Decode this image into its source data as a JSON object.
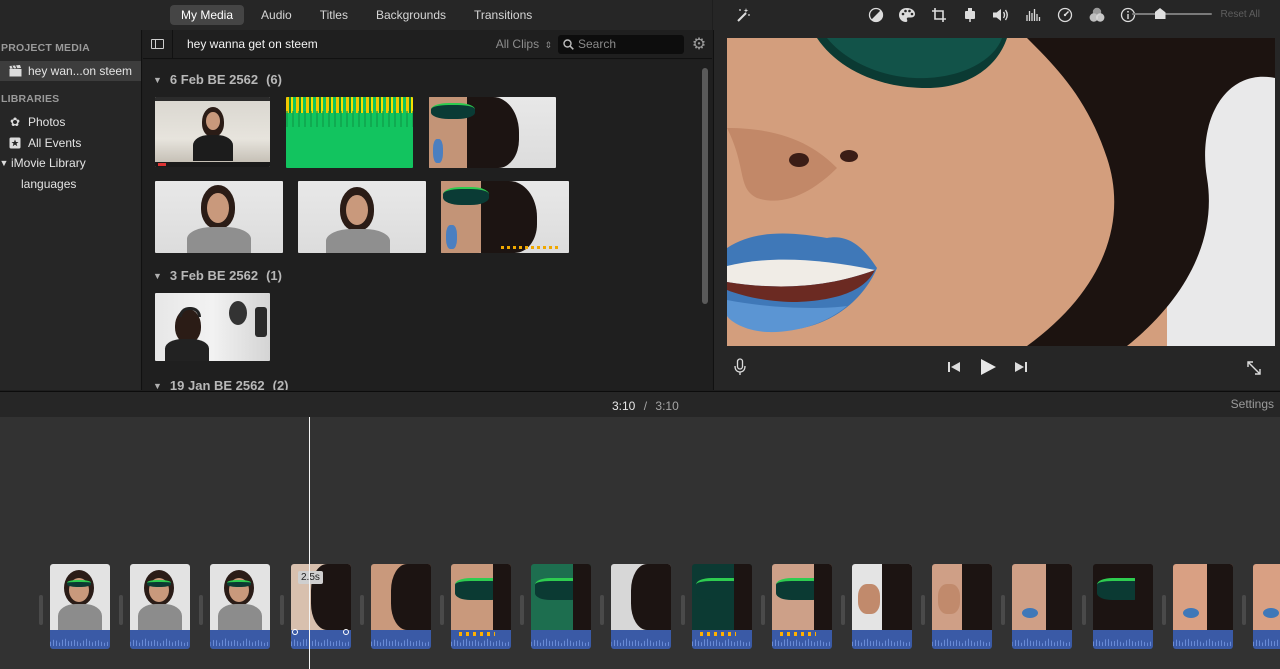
{
  "tabs": [
    {
      "label": "My Media",
      "active": true
    },
    {
      "label": "Audio",
      "active": false
    },
    {
      "label": "Titles",
      "active": false
    },
    {
      "label": "Backgrounds",
      "active": false
    },
    {
      "label": "Transitions",
      "active": false
    }
  ],
  "sidebar": {
    "project_media_heading": "PROJECT MEDIA",
    "project_item": "hey wan...on steem",
    "libraries_heading": "LIBRARIES",
    "photos": "Photos",
    "all_events": "All Events",
    "library": "iMovie Library",
    "library_child": "languages"
  },
  "browser": {
    "project_name": "hey wanna get on steem",
    "filter": "All Clips",
    "search_placeholder": "Search",
    "events": [
      {
        "title": "6 Feb BE 2562",
        "count": "(6)"
      },
      {
        "title": "3 Feb BE 2562",
        "count": "(1)"
      },
      {
        "title": "19 Jan BE 2562",
        "count": "(2)"
      }
    ]
  },
  "viewer": {
    "reset_all": "Reset All",
    "toolbar_icons": [
      "magic-wand-icon",
      "color-balance-icon",
      "color-correction-icon",
      "crop-icon",
      "stabilization-icon",
      "volume-icon",
      "noise-reduction-icon",
      "speed-icon",
      "clip-filter-icon",
      "info-icon"
    ]
  },
  "timeline": {
    "current_time": "3:10",
    "separator": "/",
    "total_time": "3:10",
    "settings_label": "Settings",
    "selected_clip_duration": "2.5s",
    "zoom_level": 0.35
  },
  "colors": {
    "accent_blue_audio": "#3a5aa6",
    "active_tab": "#454545",
    "green_screen": "#12c45f"
  }
}
